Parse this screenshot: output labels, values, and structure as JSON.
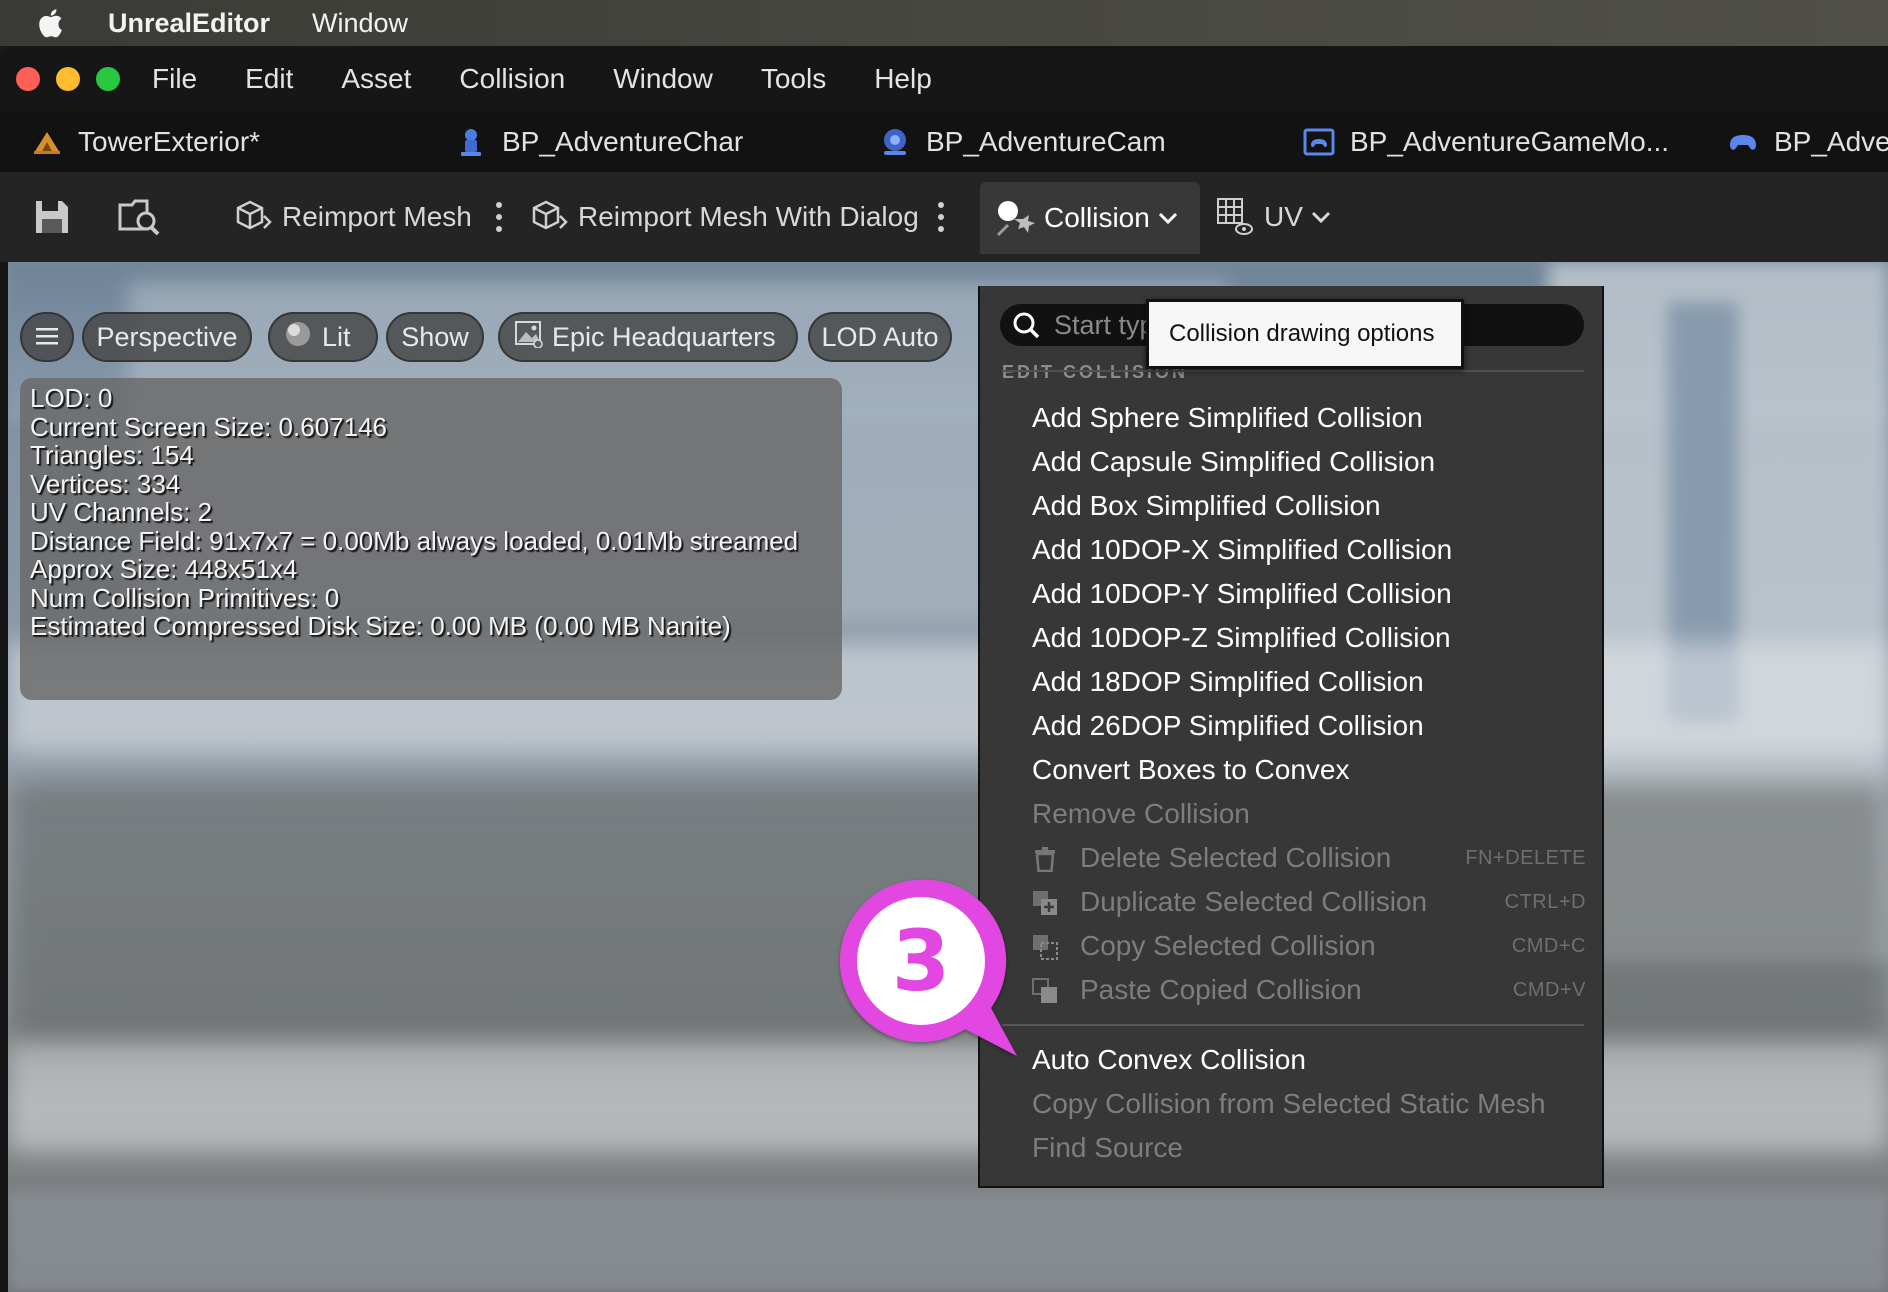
{
  "mac_menubar": {
    "app_name": "UnrealEditor",
    "menus": [
      "Window"
    ]
  },
  "window": {
    "menus": [
      "File",
      "Edit",
      "Asset",
      "Collision",
      "Window",
      "Tools",
      "Help"
    ]
  },
  "asset_tabs": [
    {
      "label": "TowerExterior*",
      "icon": "static-mesh-icon"
    },
    {
      "label": "BP_AdventureChar",
      "icon": "character-icon"
    },
    {
      "label": "BP_AdventureCam",
      "icon": "camera-actor-icon"
    },
    {
      "label": "BP_AdventureGameMo...",
      "icon": "gamemode-icon"
    },
    {
      "label": "BP_Adve",
      "icon": "gamepad-icon"
    }
  ],
  "toolbar": {
    "save_icon": "save-icon",
    "browse_icon": "browse-asset-icon",
    "reimport_label": "Reimport Mesh",
    "reimport_dialog_label": "Reimport Mesh With Dialog",
    "collision_label": "Collision",
    "uv_label": "UV"
  },
  "viewport": {
    "controls": {
      "perspective": "Perspective",
      "lit": "Lit",
      "show": "Show",
      "environment": "Epic Headquarters",
      "lod": "LOD Auto"
    },
    "stats": [
      "LOD:  0",
      "Current Screen Size:  0.607146",
      "Triangles:  154",
      "Vertices:  334",
      "UV Channels:  2",
      "Distance Field:  91x7x7 = 0.00Mb always loaded, 0.01Mb streamed",
      "Approx Size: 448x51x4",
      "Num Collision Primitives:  0",
      "Estimated Compressed Disk Size: 0.00 MB (0.00 MB Nanite)"
    ]
  },
  "collision_menu": {
    "search_placeholder": "Start typ",
    "section": "EDIT COLLISION",
    "tooltip": "Collision drawing options",
    "items": [
      {
        "label": "Add Sphere Simplified Collision",
        "enabled": true
      },
      {
        "label": "Add Capsule Simplified Collision",
        "enabled": true
      },
      {
        "label": "Add Box Simplified Collision",
        "enabled": true
      },
      {
        "label": "Add 10DOP-X Simplified Collision",
        "enabled": true
      },
      {
        "label": "Add 10DOP-Y Simplified Collision",
        "enabled": true
      },
      {
        "label": "Add 10DOP-Z Simplified Collision",
        "enabled": true
      },
      {
        "label": "Add 18DOP Simplified Collision",
        "enabled": true
      },
      {
        "label": "Add 26DOP Simplified Collision",
        "enabled": true
      },
      {
        "label": "Convert Boxes to Convex",
        "enabled": true
      },
      {
        "label": "Remove Collision",
        "enabled": false
      },
      {
        "label": "Delete Selected Collision",
        "enabled": false,
        "shortcut": "FN+DELETE",
        "icon": "trash-icon"
      },
      {
        "label": "Duplicate Selected Collision",
        "enabled": false,
        "shortcut": "CTRL+D",
        "icon": "duplicate-icon"
      },
      {
        "label": "Copy Selected Collision",
        "enabled": false,
        "shortcut": "CMD+C",
        "icon": "copy-icon"
      },
      {
        "label": "Paste Copied Collision",
        "enabled": false,
        "shortcut": "CMD+V",
        "icon": "paste-icon"
      },
      {
        "label": "Auto Convex Collision",
        "enabled": true
      },
      {
        "label": "Copy Collision from Selected Static Mesh",
        "enabled": false
      },
      {
        "label": "Find Source",
        "enabled": false
      }
    ]
  },
  "callout": {
    "step": "3"
  },
  "colors": {
    "callout_accent": "#e247e2",
    "menu_bg": "#373737",
    "tooltip_bg": "#f7f7f7"
  }
}
